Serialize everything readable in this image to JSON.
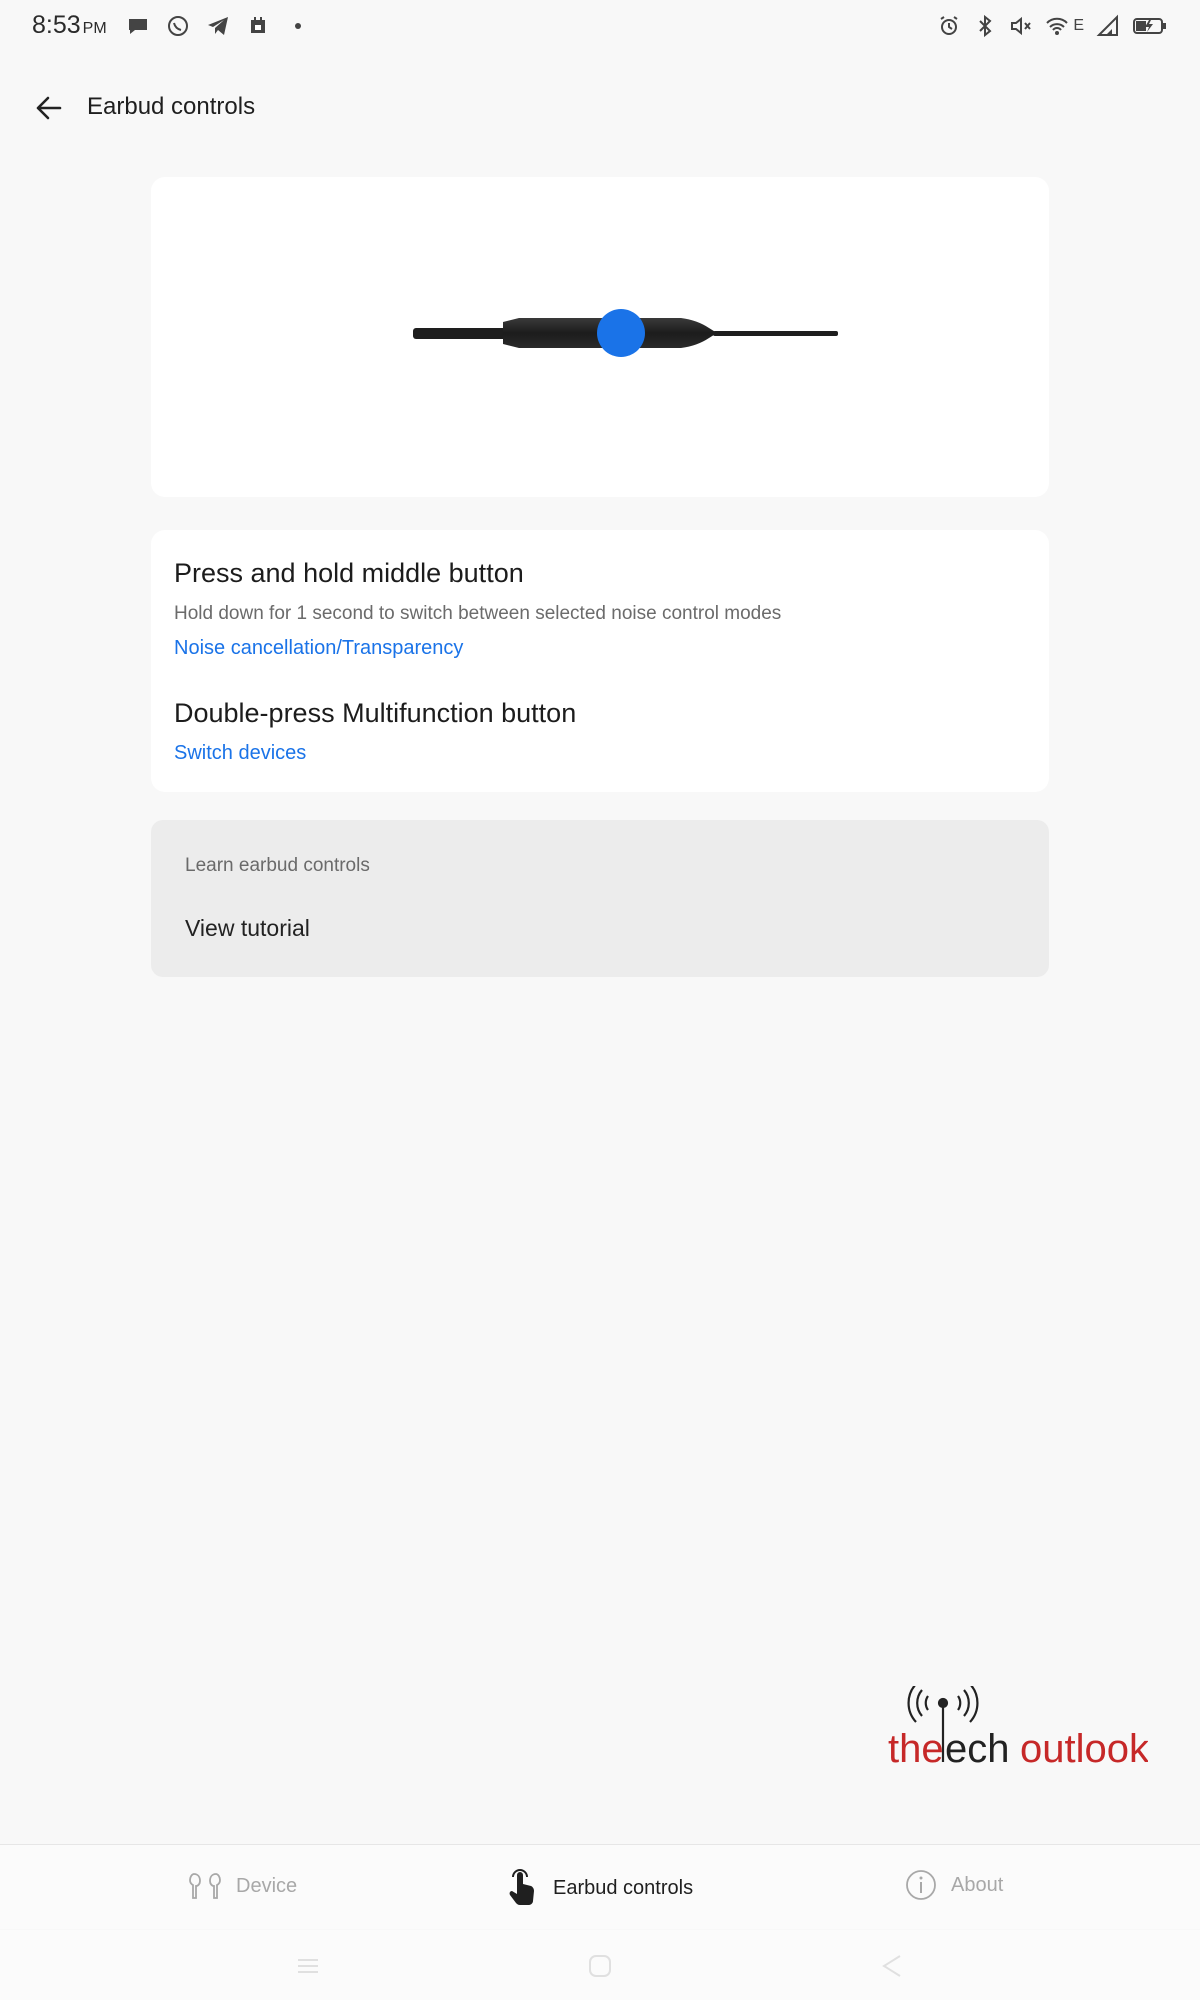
{
  "status_bar": {
    "time": "8:53",
    "ampm": "PM",
    "network_label": "E",
    "left_icons": [
      "chat-bubble-icon",
      "whatsapp-icon",
      "telegram-icon",
      "calendar-icon",
      "more-dot-icon"
    ],
    "right_icons": [
      "alarm-icon",
      "bluetooth-icon",
      "mute-icon",
      "wifi-icon",
      "signal-icon",
      "battery-charging-icon"
    ]
  },
  "header": {
    "title": "Earbud controls",
    "back_icon": "arrow-left-icon"
  },
  "illustration": {
    "description_icon": "neckband-earbud-icon",
    "highlight_color": "#1a73e8"
  },
  "controls": {
    "items": [
      {
        "title": "Press and hold middle button",
        "description": "Hold down for 1 second to switch between selected noise control modes",
        "value": "Noise cancellation/Transparency"
      },
      {
        "title": "Double-press Multifunction button",
        "value": "Switch devices"
      }
    ]
  },
  "tutorial": {
    "label": "Learn earbud controls",
    "action": "View tutorial"
  },
  "watermark": {
    "text_the": "the",
    "text_tech": "ech",
    "text_outlook": "outlook",
    "brand_color": "#c62828"
  },
  "bottom_nav": {
    "items": [
      {
        "label": "Device",
        "icon": "earbuds-icon",
        "active": false
      },
      {
        "label": "Earbud controls",
        "icon": "touch-hand-icon",
        "active": true
      },
      {
        "label": "About",
        "icon": "info-icon",
        "active": false
      }
    ]
  },
  "colors": {
    "accent": "#1a73e8",
    "background": "#f8f8f8",
    "card": "#ffffff"
  }
}
